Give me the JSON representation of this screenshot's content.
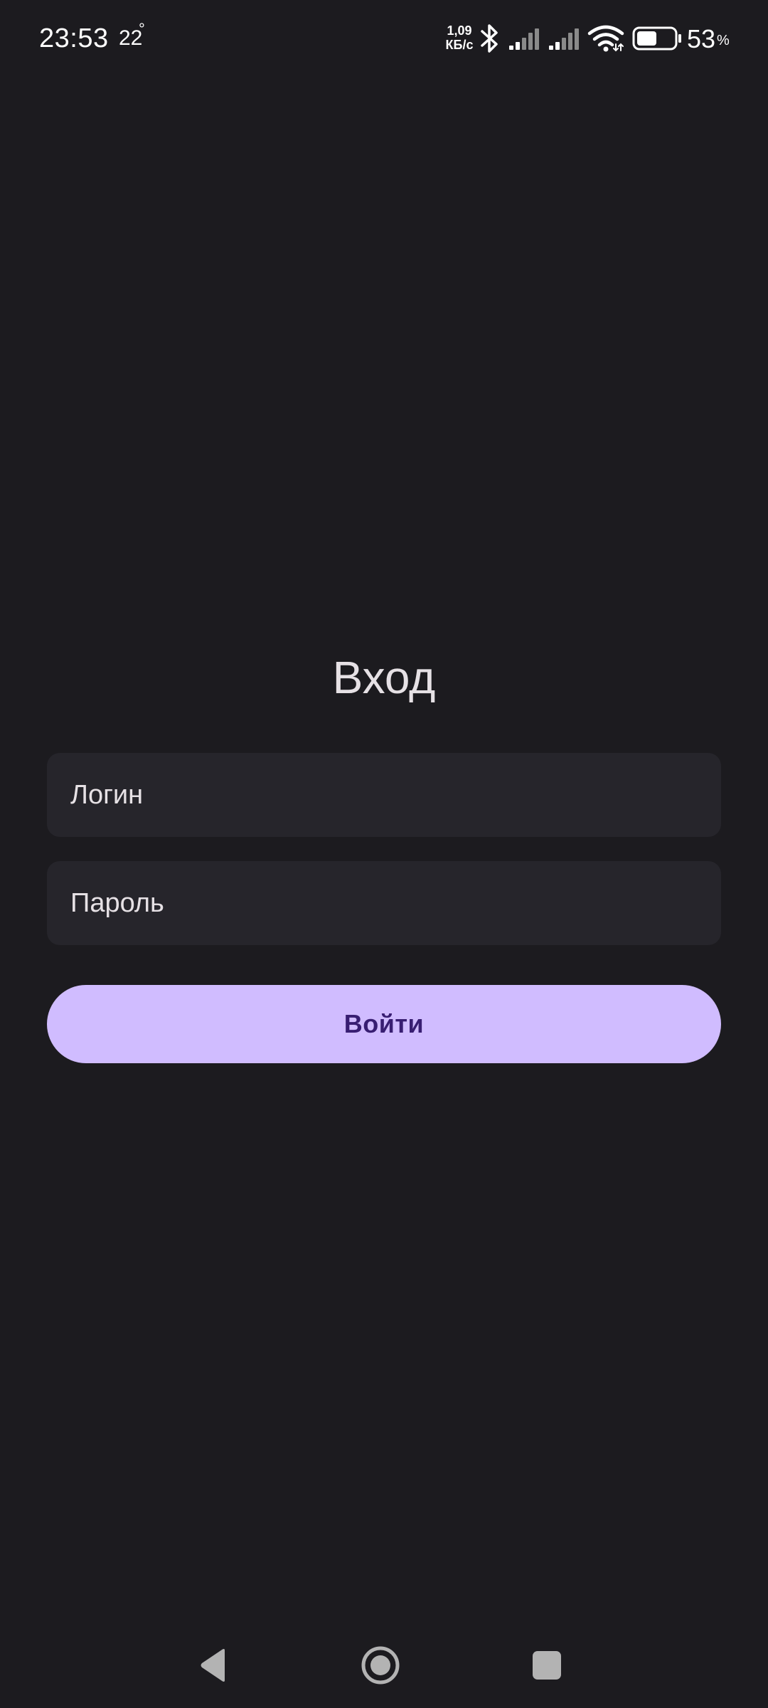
{
  "status_bar": {
    "time": "23:53",
    "temperature": "22",
    "temperature_unit": "°",
    "net_speed_value": "1,09",
    "net_speed_unit": "КБ/с",
    "battery_percent": "53",
    "battery_percent_sign": "%",
    "battery_level": 0.53,
    "icons": [
      "bluetooth-icon",
      "signal-sim1-icon",
      "signal-sim2-icon",
      "wifi-icon",
      "battery-icon"
    ]
  },
  "login": {
    "title": "Вход",
    "login_placeholder": "Логин",
    "password_placeholder": "Пароль",
    "submit_label": "Войти"
  },
  "nav_bar": {
    "icons": [
      "back-icon",
      "home-icon",
      "recents-icon"
    ]
  },
  "colors": {
    "background": "#1c1b1f",
    "field_background": "#26252b",
    "primary": "#d0bcff",
    "on_primary": "#381e72",
    "text": "#e6e1e5"
  }
}
